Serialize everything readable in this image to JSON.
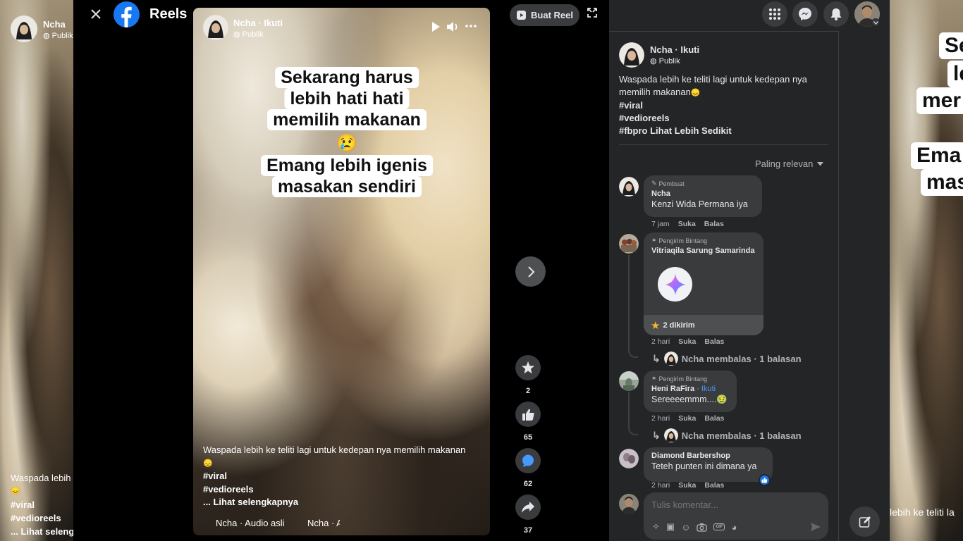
{
  "header": {
    "title": "Reels"
  },
  "left_partial": {
    "user": "Ncha",
    "privacy": "Publik",
    "caption_start": "Waspada lebih",
    "emoji": "😞",
    "tags": [
      "#viral",
      "#vedioreels"
    ],
    "see_more": "... Lihat seleng"
  },
  "video": {
    "author": "Ncha",
    "follow": "Ikuti",
    "privacy": "Publik",
    "overlay_lines": [
      "Sekarang harus",
      "lebih hati hati",
      "memilih makanan",
      "Emang lebih igenis",
      "masakan sendiri"
    ],
    "overlay_emoji": "😢",
    "caption": "Waspada lebih ke teliti lagi untuk kedepan nya memilih makanan",
    "caption_emoji": "😞",
    "tags": [
      "#viral",
      "#vedioreels"
    ],
    "see_more": "... Lihat selengkapnya",
    "audio": "Ncha · Audio asli",
    "audio_author": "Ncha · A"
  },
  "create_reel": "Buat Reel",
  "actions": {
    "star": "2",
    "likes": "65",
    "comments": "62",
    "shares": "37"
  },
  "panel": {
    "author": "Ncha",
    "follow": "Ikuti",
    "privacy": "Publik",
    "post_text": "Waspada lebih ke teliti lagi untuk kedepan nya memilih makanan",
    "post_emoji": "😞",
    "tags": [
      "#viral",
      "#vedioreels",
      "#fbpro"
    ],
    "see_less": "Lihat Lebih Sedikit",
    "sort": "Paling relevan",
    "comments": [
      {
        "badge": "Pembuat",
        "name": "Ncha",
        "text": "Kenzi Wida Permana iya",
        "time": "7 jam",
        "like": "Suka",
        "reply": "Balas"
      },
      {
        "badge": "Pengirim Bintang",
        "name": "Vitriaqila Sarung Samarinda",
        "stars": "2 dikirim",
        "time": "2 hari",
        "like": "Suka",
        "reply": "Balas",
        "reply_summary": "Ncha membalas · 1 balasan"
      },
      {
        "badge": "Pengirim Bintang",
        "name": "Heni RaFira",
        "follow": "Ikuti",
        "text": "Sereeeemmm....🤢",
        "time": "2 hari",
        "like": "Suka",
        "reply": "Balas",
        "reply_summary": "Ncha membalas · 1 balasan"
      },
      {
        "name": "Diamond Barbershop",
        "text": "Teteh punten ini dimana ya",
        "time": "2 hari",
        "like": "Suka",
        "reply": "Balas"
      }
    ],
    "input_placeholder": "Tulis komentar..."
  },
  "right_partial": {
    "overlay_lines": [
      "Se",
      "le",
      "mer",
      "Ema",
      "mas"
    ],
    "see_more": "lebih ke teliti la"
  },
  "colors": {
    "accent": "#1877f2",
    "panel_bg": "#242526",
    "bubble": "#3a3b3c"
  }
}
